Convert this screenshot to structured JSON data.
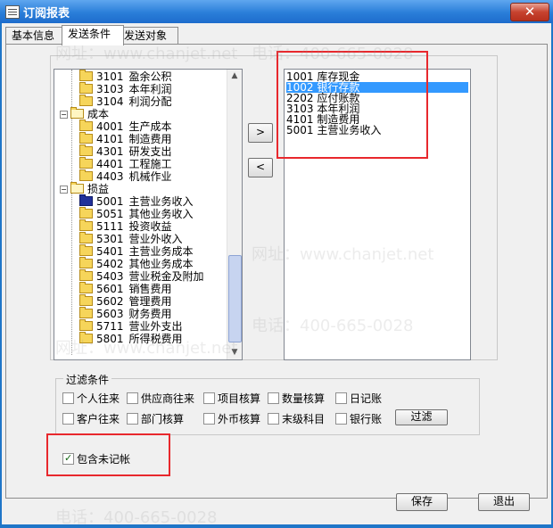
{
  "window": {
    "title": "订阅报表",
    "close_glyph": "✕"
  },
  "tabs": [
    {
      "label": "基本信息",
      "active": false
    },
    {
      "label": "发送条件",
      "active": true
    },
    {
      "label": "发送对象",
      "active": false
    }
  ],
  "tree": {
    "items": [
      {
        "code": "3101",
        "name": "盈余公积",
        "kind": "leaf"
      },
      {
        "code": "3103",
        "name": "本年利润",
        "kind": "leaf"
      },
      {
        "code": "3104",
        "name": "利润分配",
        "kind": "leaf"
      },
      {
        "code": "",
        "name": "成本",
        "kind": "group"
      },
      {
        "code": "4001",
        "name": "生产成本",
        "kind": "leaf"
      },
      {
        "code": "4101",
        "name": "制造费用",
        "kind": "leaf"
      },
      {
        "code": "4301",
        "name": "研发支出",
        "kind": "leaf"
      },
      {
        "code": "4401",
        "name": "工程施工",
        "kind": "leaf"
      },
      {
        "code": "4403",
        "name": "机械作业",
        "kind": "leaf"
      },
      {
        "code": "",
        "name": "损益",
        "kind": "group"
      },
      {
        "code": "5001",
        "name": "主营业务收入",
        "kind": "leaf-selected"
      },
      {
        "code": "5051",
        "name": "其他业务收入",
        "kind": "leaf"
      },
      {
        "code": "5111",
        "name": "投资收益",
        "kind": "leaf"
      },
      {
        "code": "5301",
        "name": "营业外收入",
        "kind": "leaf"
      },
      {
        "code": "5401",
        "name": "主营业务成本",
        "kind": "leaf"
      },
      {
        "code": "5402",
        "name": "其他业务成本",
        "kind": "leaf"
      },
      {
        "code": "5403",
        "name": "营业税金及附加",
        "kind": "leaf"
      },
      {
        "code": "5601",
        "name": "销售费用",
        "kind": "leaf"
      },
      {
        "code": "5602",
        "name": "管理费用",
        "kind": "leaf"
      },
      {
        "code": "5603",
        "name": "财务费用",
        "kind": "leaf"
      },
      {
        "code": "5711",
        "name": "营业外支出",
        "kind": "leaf"
      },
      {
        "code": "5801",
        "name": "所得税费用",
        "kind": "leaf"
      }
    ],
    "scroll_up": "▲",
    "scroll_down": "▼"
  },
  "buttons": {
    "add": ">",
    "remove": "<",
    "filter": "过滤",
    "save": "保存",
    "exit": "退出"
  },
  "selected_list": [
    {
      "text": "1001  库存现金",
      "selected": false
    },
    {
      "text": "1002  银行存款",
      "selected": true
    },
    {
      "text": "2202  应付账款",
      "selected": false
    },
    {
      "text": "3103  本年利润",
      "selected": false
    },
    {
      "text": "4101  制造费用",
      "selected": false
    },
    {
      "text": "5001  主营业务收入",
      "selected": false
    }
  ],
  "filter": {
    "legend": "过滤条件",
    "row1": [
      "个人往来",
      "供应商往来",
      "项目核算",
      "数量核算",
      "日记账"
    ],
    "row2": [
      "客户往来",
      "部门核算",
      "外币核算",
      "末级科目",
      "银行账"
    ]
  },
  "include_unposted": {
    "label": "包含未记帐",
    "checked": true
  },
  "watermarks": {
    "phone": "电话：400-665-0028",
    "site": "网址：www.chanjet.net"
  }
}
